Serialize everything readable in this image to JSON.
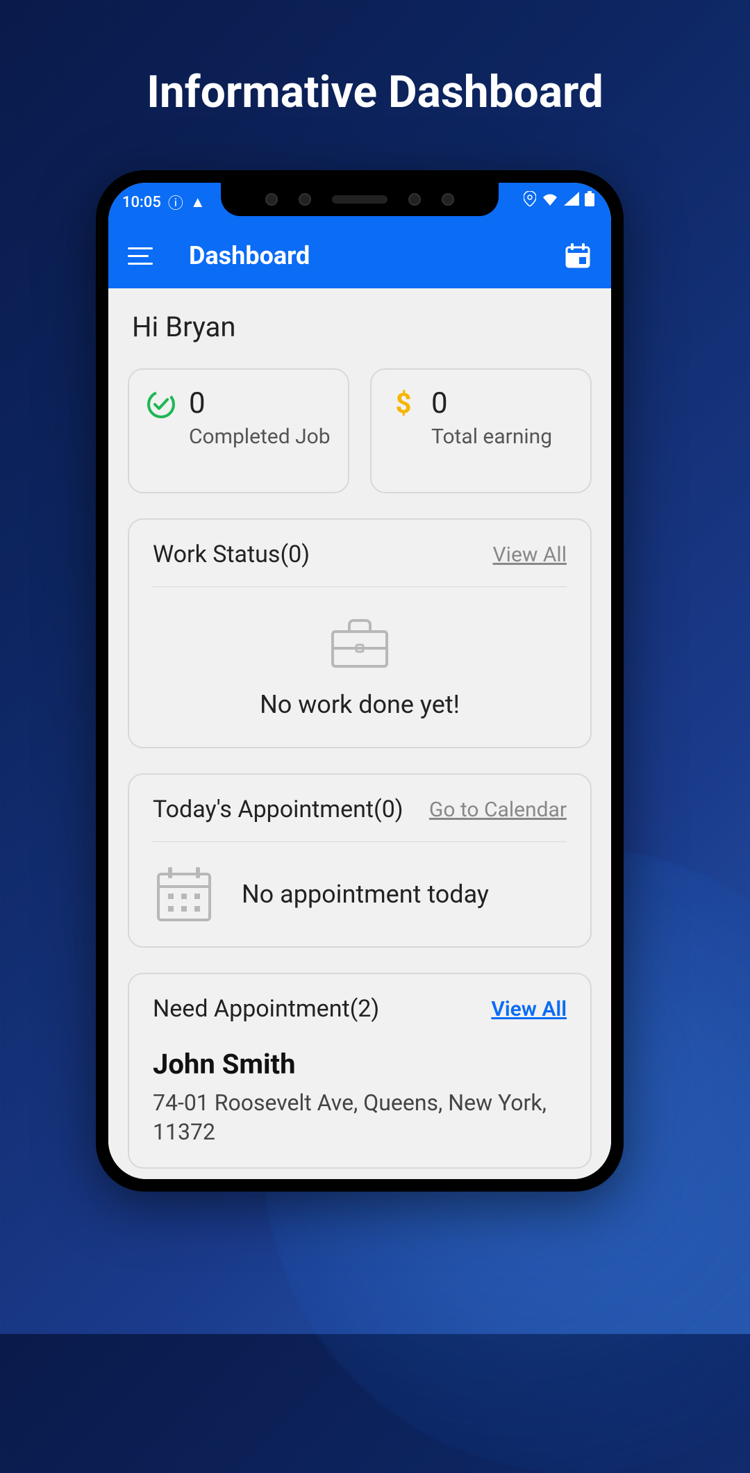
{
  "marketing": {
    "title": "Informative Dashboard"
  },
  "status_bar": {
    "time": "10:05"
  },
  "app_bar": {
    "title": "Dashboard"
  },
  "greeting": "Hi Bryan",
  "stats": {
    "completed": {
      "value": "0",
      "label": "Completed Job"
    },
    "earning": {
      "value": "0",
      "label": "Total earning"
    }
  },
  "work_status": {
    "title": "Work Status(0)",
    "link": "View All",
    "empty": "No work done yet!"
  },
  "today_appt": {
    "title": "Today's Appointment(0)",
    "link": "Go to Calendar",
    "empty": "No appointment today"
  },
  "need_appt": {
    "title": "Need Appointment(2)",
    "link": "View All",
    "name": "John Smith",
    "address": "74-01 Roosevelt Ave, Queens, New York, 11372"
  }
}
